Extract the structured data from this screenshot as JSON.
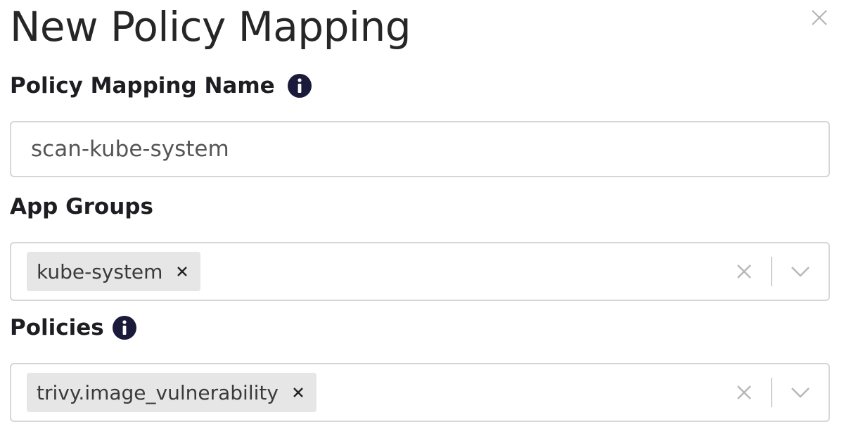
{
  "dialog": {
    "title": "New Policy Mapping",
    "close_icon": "close-icon"
  },
  "fields": {
    "name": {
      "label": "Policy Mapping Name",
      "info_icon": "info-icon",
      "value": "scan-kube-system"
    },
    "app_groups": {
      "label": "App Groups",
      "selected": [
        "kube-system"
      ]
    },
    "policies": {
      "label": "Policies",
      "info_icon": "info-icon",
      "selected": [
        "trivy.image_vulnerability"
      ]
    }
  },
  "colors": {
    "info_icon_fill": "#1a1a3a",
    "chip_background": "#e6e6e6",
    "border": "#d6d6d6"
  }
}
